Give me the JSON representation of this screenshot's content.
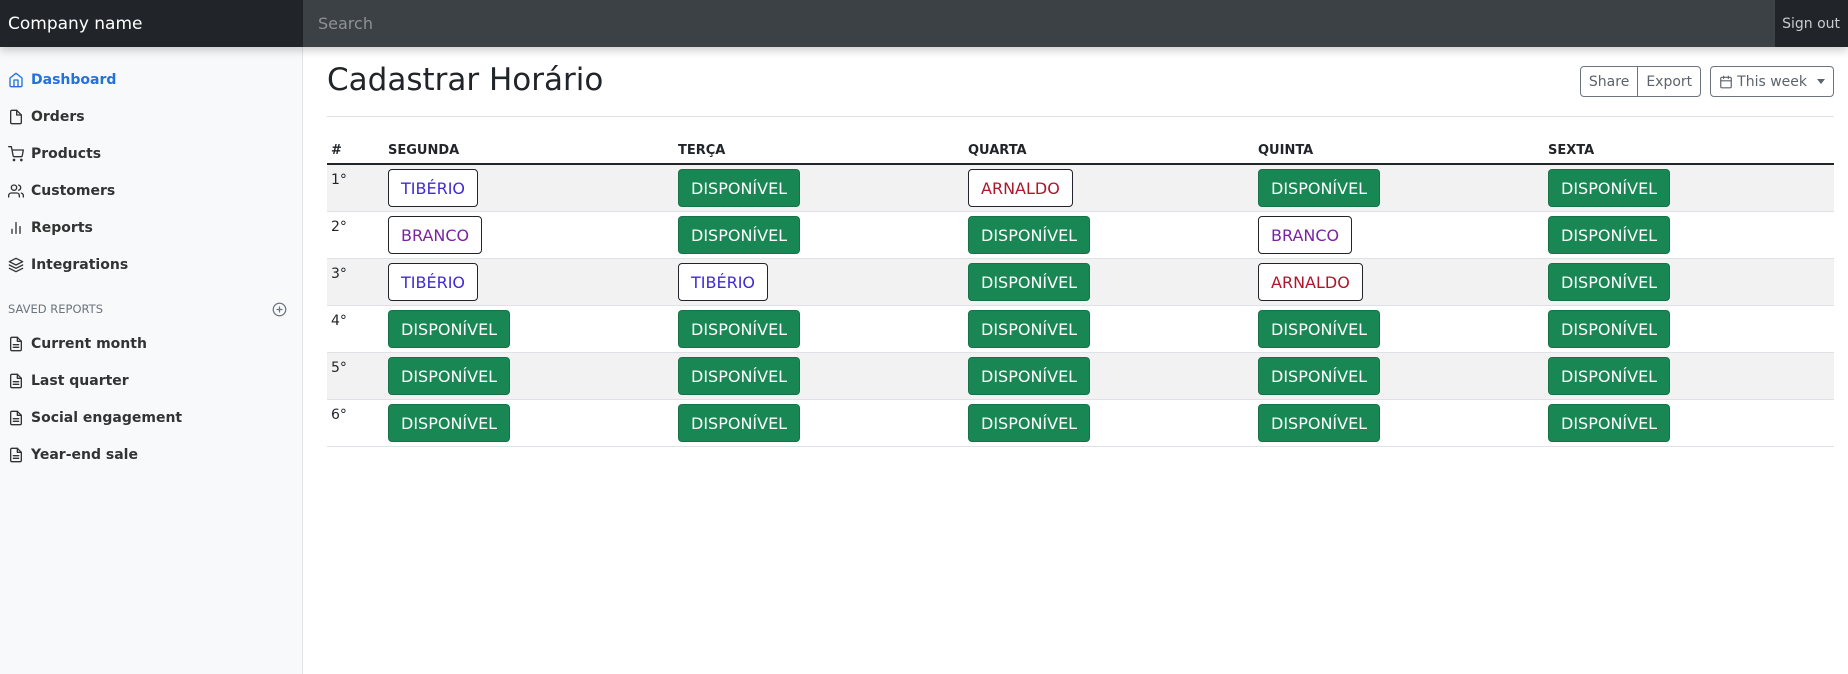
{
  "topbar": {
    "brand": "Company name",
    "search_placeholder": "Search",
    "signout": "Sign out"
  },
  "sidebar": {
    "items": [
      {
        "label": "Dashboard",
        "icon": "home-icon",
        "active": true
      },
      {
        "label": "Orders",
        "icon": "file-icon",
        "active": false
      },
      {
        "label": "Products",
        "icon": "cart-icon",
        "active": false
      },
      {
        "label": "Customers",
        "icon": "users-icon",
        "active": false
      },
      {
        "label": "Reports",
        "icon": "bar-chart-icon",
        "active": false
      },
      {
        "label": "Integrations",
        "icon": "layers-icon",
        "active": false
      }
    ],
    "saved_heading": "SAVED REPORTS",
    "saved": [
      {
        "label": "Current month",
        "icon": "file-text-icon"
      },
      {
        "label": "Last quarter",
        "icon": "file-text-icon"
      },
      {
        "label": "Social engagement",
        "icon": "file-text-icon"
      },
      {
        "label": "Year-end sale",
        "icon": "file-text-icon"
      }
    ]
  },
  "main": {
    "title": "Cadastrar Horário",
    "share": "Share",
    "export": "Export",
    "week": "This week"
  },
  "colors": {
    "free": "#198754",
    "TIBÉRIO": "#3f2bd6",
    "BRANCO": "#7a23a3",
    "ARNALDO": "#b0162b"
  },
  "schedule": {
    "headers": [
      "#",
      "SEGUNDA",
      "TERÇA",
      "QUARTA",
      "QUINTA",
      "SEXTA"
    ],
    "rows": [
      {
        "n": "1°",
        "cells": [
          "TIBÉRIO",
          "DISPONÍVEL",
          "ARNALDO",
          "DISPONÍVEL",
          "DISPONÍVEL"
        ]
      },
      {
        "n": "2°",
        "cells": [
          "BRANCO",
          "DISPONÍVEL",
          "DISPONÍVEL",
          "BRANCO",
          "DISPONÍVEL"
        ]
      },
      {
        "n": "3°",
        "cells": [
          "TIBÉRIO",
          "TIBÉRIO",
          "DISPONÍVEL",
          "ARNALDO",
          "DISPONÍVEL"
        ]
      },
      {
        "n": "4°",
        "cells": [
          "DISPONÍVEL",
          "DISPONÍVEL",
          "DISPONÍVEL",
          "DISPONÍVEL",
          "DISPONÍVEL"
        ]
      },
      {
        "n": "5°",
        "cells": [
          "DISPONÍVEL",
          "DISPONÍVEL",
          "DISPONÍVEL",
          "DISPONÍVEL",
          "DISPONÍVEL"
        ]
      },
      {
        "n": "6°",
        "cells": [
          "DISPONÍVEL",
          "DISPONÍVEL",
          "DISPONÍVEL",
          "DISPONÍVEL",
          "DISPONÍVEL"
        ]
      }
    ]
  }
}
